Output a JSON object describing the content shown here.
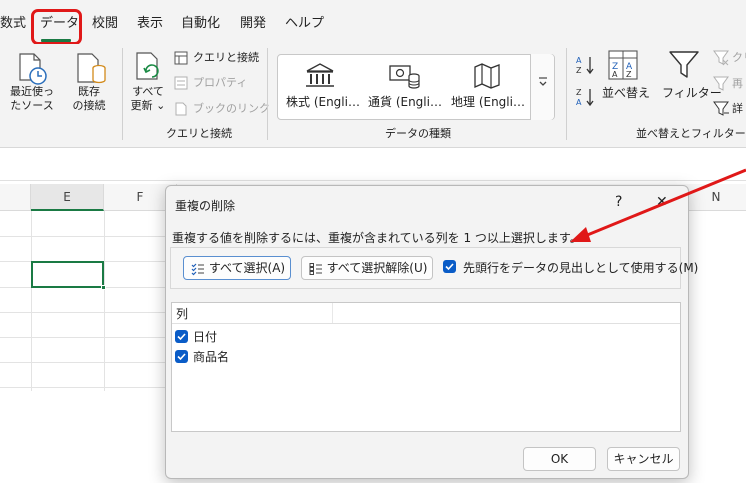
{
  "tabs": [
    {
      "label": "数式",
      "active": false
    },
    {
      "label": "データ",
      "active": true
    },
    {
      "label": "校閲",
      "active": false
    },
    {
      "label": "表示",
      "active": false
    },
    {
      "label": "自動化",
      "active": false
    },
    {
      "label": "開発",
      "active": false
    },
    {
      "label": "ヘルプ",
      "active": false
    }
  ],
  "ribbon": {
    "recent_sources": {
      "line1": "最近使っ",
      "line2": "たソース"
    },
    "existing_connections": {
      "line1": "既存",
      "line2": "の接続"
    },
    "refresh_all": {
      "line1": "すべて",
      "line2": "更新"
    },
    "queries_connections": "クエリと接続",
    "properties": "プロパティ",
    "edit_links": "ブックのリンク",
    "group_queries": "クエリと接続",
    "data_types": [
      "株式 (Engli…",
      "通貨 (Engli…",
      "地理 (Engli…"
    ],
    "group_data_types": "データの種類",
    "sort": "並べ替え",
    "filter": "フィルター",
    "clear": "クリ",
    "reapply": "再",
    "advanced": "詳",
    "group_sort_filter": "並べ替えとフィルター"
  },
  "sheet": {
    "columns": [
      "E",
      "F",
      "N"
    ]
  },
  "dialog": {
    "title": "重複の削除",
    "help": "?",
    "close": "✕",
    "instruction": "重複する値を削除するには、重複が含まれている列を 1 つ以上選択します。",
    "select_all": "すべて選択(A)",
    "unselect_all": "すべて選択解除(U)",
    "header_option": {
      "label": "先頭行をデータの見出しとして使用する(M)",
      "checked": true
    },
    "list_header": "列",
    "columns": [
      {
        "label": "日付",
        "checked": true
      },
      {
        "label": "商品名",
        "checked": true
      }
    ],
    "ok": "OK",
    "cancel": "キャンセル"
  },
  "colors": {
    "highlight": "#e01818",
    "annotation_arrow": "#e01818",
    "excel_green": "#1a7a44",
    "checkbox": "#0a5cc7"
  }
}
